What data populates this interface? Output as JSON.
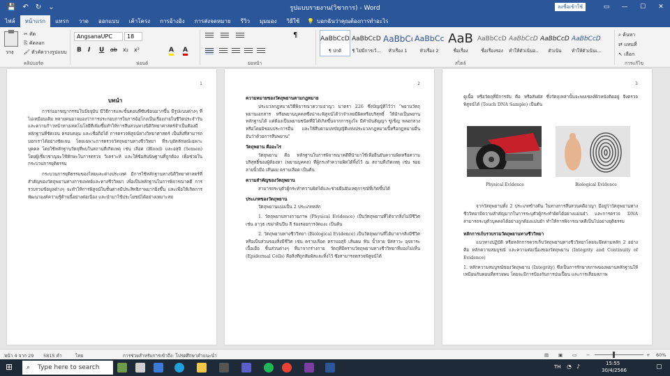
{
  "titlebar": {
    "title": "รูปแบบรายงาน(วิชาการ) - Word",
    "signin": "ลงชื่อเข้าใช้"
  },
  "tabs": [
    "ไฟล์",
    "หน้าแรก",
    "แทรก",
    "วาด",
    "ออกแบบ",
    "เค้าโครง",
    "การอ้างอิง",
    "การส่งจดหมาย",
    "รีวิว",
    "มุมมอง",
    "วิธีใช้"
  ],
  "tell_me": "บอกฉันว่าคุณต้องการทำอะไร",
  "ribbon": {
    "paste": "วาง",
    "clipboard": [
      "ตัด",
      "คัดลอก",
      "ตัวคัดวางรูปแบบ"
    ],
    "font_name": "AngsanaUPC",
    "font_size": "18",
    "format_buttons": [
      "B",
      "I",
      "U",
      "ab",
      "x₂",
      "x²",
      "A",
      "A"
    ],
    "styles": [
      {
        "sample": "AaBbCcDd",
        "name": "¶ ปกติ"
      },
      {
        "sample": "AaBbCcDd",
        "name": "¶ ไม่มีการเว้..."
      },
      {
        "sample": "AaBbCc",
        "name": "หัวเรื่อง 1"
      },
      {
        "sample": "AaBbCcE",
        "name": "หัวเรื่อง 2"
      },
      {
        "sample": "AaB",
        "name": "ชื่อเรื่อง"
      },
      {
        "sample": "AaBbCcDd",
        "name": "ชื่อเรื่องรอง"
      },
      {
        "sample": "AaBbCcDd",
        "name": "ทำให้ตัวเน้นอ..."
      },
      {
        "sample": "AaBbCcDd",
        "name": "ตัวเน้น"
      },
      {
        "sample": "AaBbCcDd",
        "name": "ทำให้ตัวเน้นเ..."
      }
    ],
    "editing": [
      "ค้นหา",
      "แทนที่",
      "เลือก"
    ],
    "groups": [
      "คลิปบอร์ด",
      "ฟอนต์",
      "ย่อหน้า",
      "สไตล์",
      "การแก้ไข"
    ]
  },
  "pages": [
    {
      "number": "1",
      "title": "บทนำ",
      "paragraphs": [
        "การก่ออาชญากรรมในปัจจุบัน มีวิธีการและขั้นตอนที่ซับซ้อนมากขึ้น มีรูปแบบต่างๆ ที่ไม่เหมือนเดิม หลายคนอาจมองว่าการประกอบการในการฉ้อโกงเป็นเรื่องง่ายในชีวิตประจำวัน และความก้าวหน้าทางเทคโนโลยีที่เพิ่มขึ้นทำให้การสืบสวนทางนิติวิทยาศาสตร์จำเป็นต้องมีหลักฐานที่ชัดเจน ครอบคลุม และเชื่อถือได้ การตรวจพิสูจน์ทางวิทยาศาสตร์ เป็นสิ่งที่สามารถบอกเราได้อย่างชัดเจน โดยเฉพาะการตรวจวัตถุพยานทางชีววิทยา ที่ระบุอัตลักษณ์เฉพาะบุคคล โดยใช้หลักฐานวัตถุที่พบในสถานที่เกิดเหตุ เช่น เลือด (Blood) และอสุจิ (Semen) โดยผู้เชี่ยวชาญจะใช้ทักษะในการตรวจ วิเคราะห์ และให้ข้อสันนิษฐานที่ถูกต้อง เพื่อช่วยในกระบวนการยุติธรรม",
        "กระบวนการยุติธรรมของไทยและต่างประเทศ มีการใช้หลักฐานทางนิติวิทยาศาสตร์ที่สำคัญของวัตถุพยานทางการแพทย์และทางชีววิทยา เพื่อเป็นหลักฐานในการพิจารณาคดี การรวบรวมข้อมูลต่างๆ จะทำให้การพิสูจน์ในชั้นศาลมีประสิทธิภาพมากยิ่งขึ้น และเพื่อให้เกิดการพัฒนาองค์ความรู้ด้านนี้อย่างต่อเนื่อง และนำมาใช้ประโยชน์ได้อย่างเหมาะสม"
      ]
    },
    {
      "number": "2",
      "heading1": "ความหมายของวัตถุพยานตามกฎหมาย",
      "para1": "ประมวลกฎหมายวิธีพิจารณาความอาญา มาตรา 226 ซึ่งบัญญัติไว้ว่า \"พยานวัตถุ พยานเอกสาร หรือพยานบุคคลซึ่งน่าจะพิสูจน์ได้ว่าจำเลยมีผิดหรือบริสุทธิ์ ให้อ้างเป็นพยานหลักฐานได้ แต่ต้องเป็นพยานชนิดที่มิได้เกิดขึ้นจากการจูงใจ มีคำมั่นสัญญา ขู่เข็ญ หลอกลวงหรือโดยมิชอบประการอื่น และให้สืบตามบทบัญญัติแห่งประมวลกฎหมายนี้หรือกฎหมายอื่นอันว่าด้วยการสืบพยาน\"",
      "heading2": "วัตถุพยาน คืออะไร",
      "para2": "วัตถุพยาน คือ หลักฐานในการพิจารณาคดีที่นำมาใช้เพื่อยืนยันความผิดหรือความบริสุทธิ์ของผู้ต้องหา (พยานบุคคล) ที่ผู้กระทำความผิดได้ทิ้งไว้ ณ สถานที่เกิดเหตุ เช่น รอยลายนิ้วมือ เส้นผม คราบเลือด เป็นต้น",
      "heading3": "ความสำคัญของวัตถุพยาน",
      "para3": "สามารถระบุตัวผู้กระทำความผิดได้และช่วยยืนยันเหตุการณ์ที่เกิดขึ้นได้",
      "heading4": "ประเภทของวัตถุพยาน",
      "para4": "วัตถุพยานแบ่งเป็น 2 ประเภทหลัก",
      "list1": "1. วัตถุพยานทางกายภาพ (Physical Evidence) เป็นวัตถุพยานที่ได้จากสิ่งไม่มีชีวิต เช่น อาวุธ เขม่าดินปืน สี ร่องรอยการงัดแงะ เป็นต้น",
      "list2": "2. วัตถุพยานทางชีววิทยา (Biological Evidence) เป็นวัตถุพยานที่ได้มาจากสิ่งมีชีวิตหรือเป็นส่วนของสิ่งมีชีวิต เช่น คราบเลือด คราบอสุจิ เส้นผม ฟัน น้ำลาย ปัสสาวะ อุจจาระ เนื้อเยื่อ ชิ้นส่วนต่างๆ ที่มาจากร่างกาย วัตถุที่มีคราบวัตถุพยานทางชีววิทยาที่มองไม่เห็น (Epidermal Cells) คือสิ่งที่ถูกสัมผัสและทิ้งไว้ ซึ่งสามารถตรวจพิสูจน์ได้"
    },
    {
      "number": "3",
      "intro": "ดูเนื้อ หรือวัตถุที่มีการจับ คือ หรือสัมผัส ซึ่งวัตถุเหล่านั้นจะพบเซลล์ผิวหนังติดอยู่ จึงตรวจพิสูจน์ได้ (Touch DNA Sample) เป็นต้น",
      "caption1": "Physical Evidence",
      "caption2": "Biological Evidence",
      "para1": "จากวัตถุพยานทั้ง 2 ประเภทข้างต้น ในทางการสืบสวนคดีอาญา มีอยู่ว่าวัตถุพยานทางชีววิทยามีความสำคัญมากในการระบุตัวผู้กระทำผิดได้อย่างแม่นยำ และการตรวจ DNA สามารถระบุตัวบุคคลได้อย่างถูกต้องแม่นยำ ทำให้การพิจารณาคดีเป็นไปอย่างยุติธรรม",
      "heading": "หลักการเก็บรวบรวมวัตถุพยานทางชีววิทยา",
      "para2": "แนวทางปฏิบัติ หรือหลักการควรเก็บวัตถุพยานทางชีววิทยาโดยจะยึดตามหลัก 2 อย่าง คือ หลักความสมบูรณ์ และความต่อเนื่องของวัตถุพยาน (Integrity and Continuity of Evidence)",
      "list1": "1. หลักความสมบูรณ์ของวัตถุพยาน (Integrity) ซึ่งเป็นการรักษาสภาพของพยานหลักฐานให้เหมือนกับตอนที่ตรวจพบ โดยจะมีการป้องกันการปนเปื้อน และการเสื่อมสภาพ"
    }
  ],
  "status": {
    "page": "หน้า 4 จาก 29",
    "words": "5815 คำ",
    "lang": "ไทย",
    "accessibility": "การช่วยสำหรับการเข้าถึง: โปรดศึกษาคำแนะนำ",
    "zoom": "60%"
  },
  "taskbar": {
    "search": "Type here to search",
    "lang": "TH",
    "time": "15:55",
    "date": "30/4/2566"
  }
}
